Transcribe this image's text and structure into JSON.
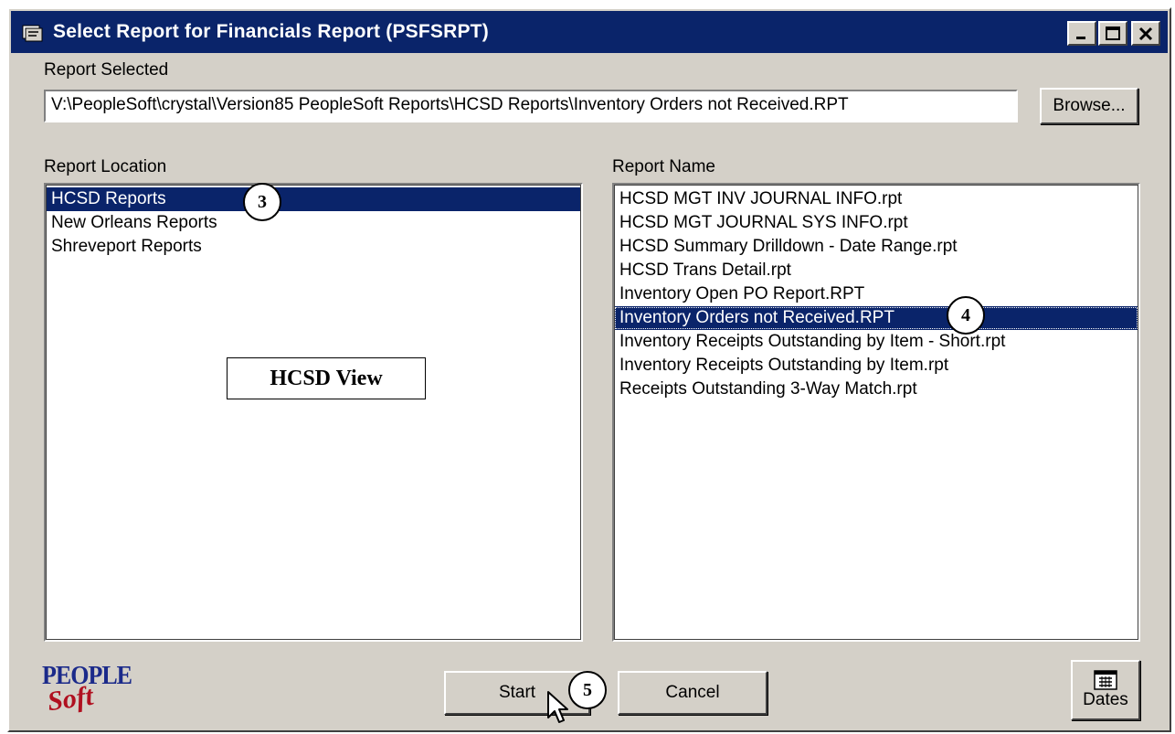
{
  "window": {
    "title": "Select Report for Financials Report (PSFSRPT)",
    "title_icon": "app-icon",
    "controls": [
      "minimize-icon",
      "maximize-icon",
      "close-icon"
    ]
  },
  "report_selected": {
    "label": "Report Selected",
    "value": "V:\\PeopleSoft\\crystal\\Version85 PeopleSoft Reports\\HCSD Reports\\Inventory Orders not Received.RPT",
    "browse_label": "Browse..."
  },
  "report_location": {
    "label": "Report Location",
    "items": [
      "HCSD Reports",
      "New Orleans Reports",
      "Shreveport Reports"
    ],
    "selected_index": 0
  },
  "report_name": {
    "label": "Report Name",
    "items": [
      "HCSD MGT INV JOURNAL INFO.rpt",
      "HCSD MGT JOURNAL SYS INFO.rpt",
      "HCSD Summary Drilldown - Date Range.rpt",
      "HCSD Trans Detail.rpt",
      "Inventory Open PO Report.RPT",
      "Inventory Orders not Received.RPT",
      "Inventory Receipts Outstanding by Item - Short.rpt",
      "Inventory Receipts Outstanding by Item.rpt",
      "Receipts Outstanding 3-Way Match.rpt"
    ],
    "selected_index": 5
  },
  "annotations": {
    "view_label": "HCSD View",
    "step_3": "3",
    "step_4": "4",
    "step_5": "5"
  },
  "buttons": {
    "start": "Start",
    "cancel": "Cancel",
    "dates": "Dates"
  },
  "logo": {
    "line1": "PEOPLE",
    "line2": "Soft"
  },
  "colors": {
    "titlebar": "#0a246a",
    "selection": "#0a246a",
    "face": "#d4d0c8"
  }
}
